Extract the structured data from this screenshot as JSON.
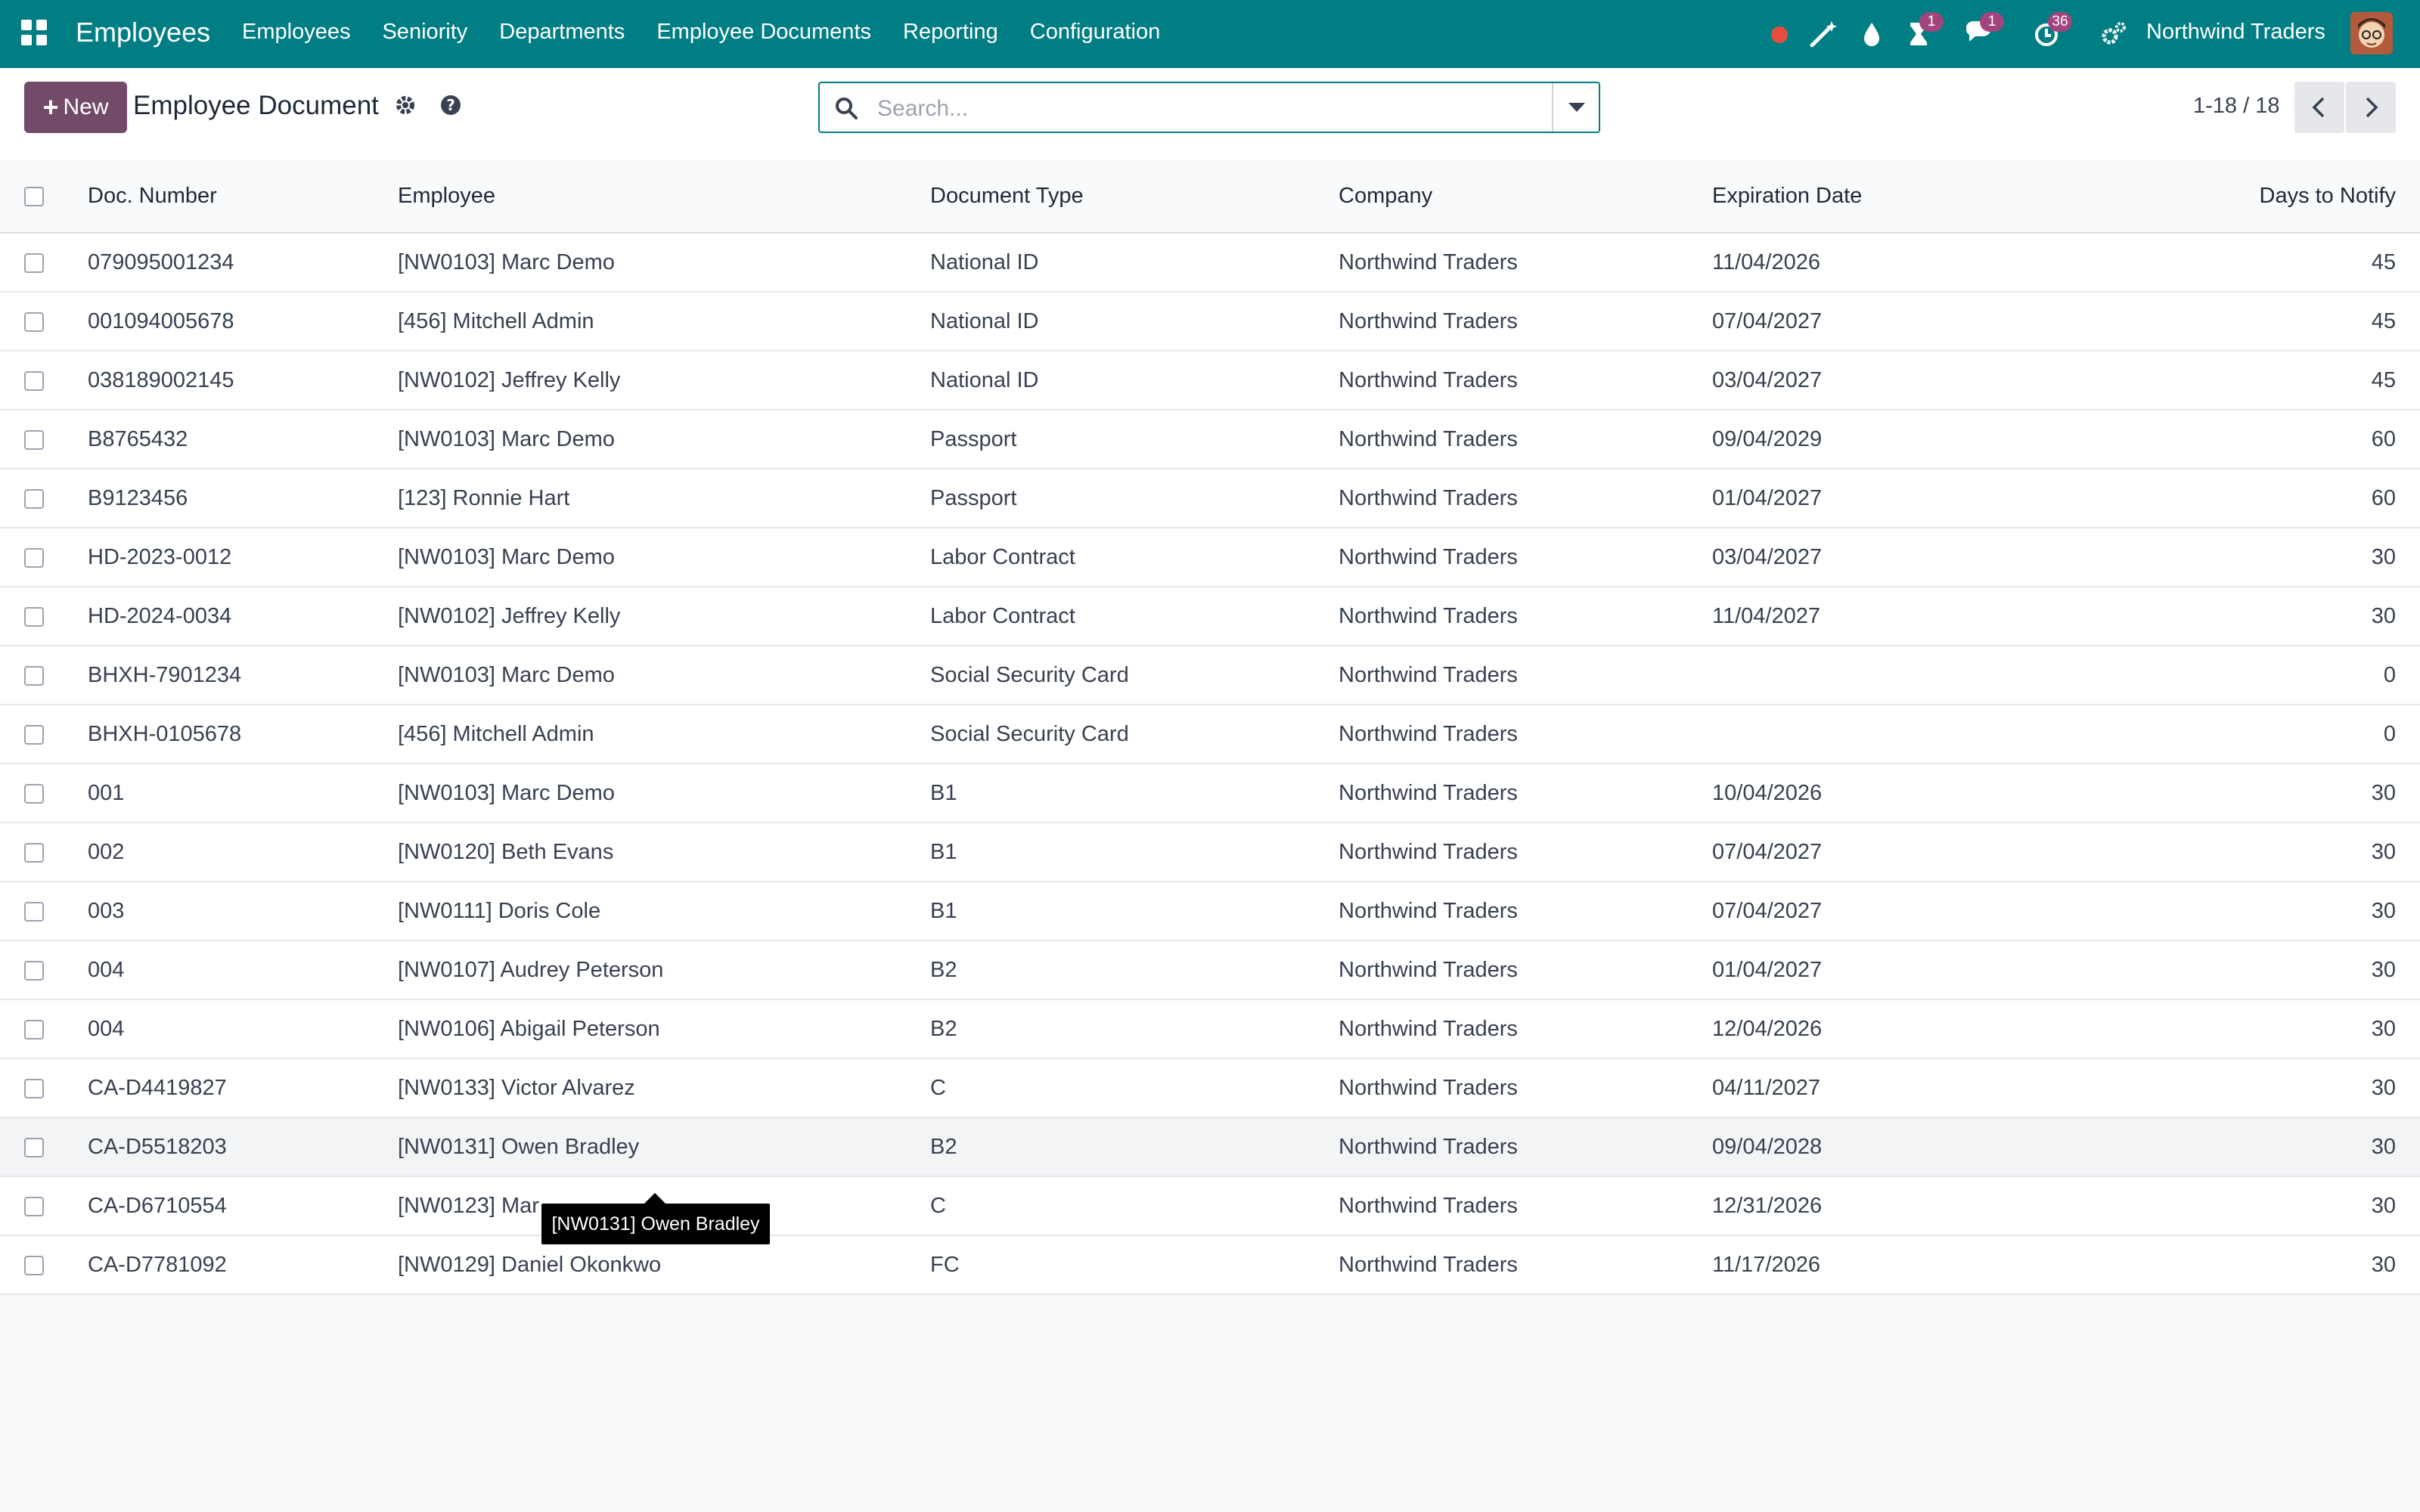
{
  "navbar": {
    "app_name": "Employees",
    "menu": [
      "Employees",
      "Seniority",
      "Departments",
      "Employee Documents",
      "Reporting",
      "Configuration"
    ],
    "activity_badge": "1",
    "messages_badge": "1",
    "clock_badge": "36",
    "company": "Northwind Traders",
    "icons": [
      "record-dot-icon",
      "magic-wand-icon",
      "water-drop-icon",
      "hourglass-icon",
      "chat-icon",
      "clock-icon",
      "settings-icon"
    ]
  },
  "control_panel": {
    "new_label": "New",
    "title": "Employee Document",
    "search_placeholder": "Search...",
    "pager": "1-18 / 18"
  },
  "columns": [
    "Doc. Number",
    "Employee",
    "Document Type",
    "Company",
    "Expiration Date",
    "Days to Notify"
  ],
  "rows": [
    {
      "doc": "079095001234",
      "employee": "[NW0103] Marc Demo",
      "type": "National ID",
      "company": "Northwind Traders",
      "expiration": "11/04/2026",
      "days": "45"
    },
    {
      "doc": "001094005678",
      "employee": "[456] Mitchell Admin",
      "type": "National ID",
      "company": "Northwind Traders",
      "expiration": "07/04/2027",
      "days": "45"
    },
    {
      "doc": "038189002145",
      "employee": "[NW0102] Jeffrey Kelly",
      "type": "National ID",
      "company": "Northwind Traders",
      "expiration": "03/04/2027",
      "days": "45"
    },
    {
      "doc": "B8765432",
      "employee": "[NW0103] Marc Demo",
      "type": "Passport",
      "company": "Northwind Traders",
      "expiration": "09/04/2029",
      "days": "60"
    },
    {
      "doc": "B9123456",
      "employee": "[123] Ronnie Hart",
      "type": "Passport",
      "company": "Northwind Traders",
      "expiration": "01/04/2027",
      "days": "60"
    },
    {
      "doc": "HD-2023-0012",
      "employee": "[NW0103] Marc Demo",
      "type": "Labor Contract",
      "company": "Northwind Traders",
      "expiration": "03/04/2027",
      "days": "30"
    },
    {
      "doc": "HD-2024-0034",
      "employee": "[NW0102] Jeffrey Kelly",
      "type": "Labor Contract",
      "company": "Northwind Traders",
      "expiration": "11/04/2027",
      "days": "30"
    },
    {
      "doc": "BHXH-7901234",
      "employee": "[NW0103] Marc Demo",
      "type": "Social Security Card",
      "company": "Northwind Traders",
      "expiration": "",
      "days": "0"
    },
    {
      "doc": "BHXH-0105678",
      "employee": "[456] Mitchell Admin",
      "type": "Social Security Card",
      "company": "Northwind Traders",
      "expiration": "",
      "days": "0"
    },
    {
      "doc": "001",
      "employee": "[NW0103] Marc Demo",
      "type": "B1",
      "company": "Northwind Traders",
      "expiration": "10/04/2026",
      "days": "30"
    },
    {
      "doc": "002",
      "employee": "[NW0120] Beth Evans",
      "type": "B1",
      "company": "Northwind Traders",
      "expiration": "07/04/2027",
      "days": "30"
    },
    {
      "doc": "003",
      "employee": "[NW0111] Doris Cole",
      "type": "B1",
      "company": "Northwind Traders",
      "expiration": "07/04/2027",
      "days": "30"
    },
    {
      "doc": "004",
      "employee": "[NW0107] Audrey Peterson",
      "type": "B2",
      "company": "Northwind Traders",
      "expiration": "01/04/2027",
      "days": "30"
    },
    {
      "doc": "004",
      "employee": "[NW0106] Abigail Peterson",
      "type": "B2",
      "company": "Northwind Traders",
      "expiration": "12/04/2026",
      "days": "30"
    },
    {
      "doc": "CA-D4419827",
      "employee": "[NW0133] Victor Alvarez",
      "type": "C",
      "company": "Northwind Traders",
      "expiration": "04/11/2027",
      "days": "30"
    },
    {
      "doc": "CA-D5518203",
      "employee": "[NW0131] Owen Bradley",
      "type": "B2",
      "company": "Northwind Traders",
      "expiration": "09/04/2028",
      "days": "30"
    },
    {
      "doc": "CA-D6710554",
      "employee": "[NW0123] Mar",
      "type": "C",
      "company": "Northwind Traders",
      "expiration": "12/31/2026",
      "days": "30"
    },
    {
      "doc": "CA-D7781092",
      "employee": "[NW0129] Daniel Okonkwo",
      "type": "FC",
      "company": "Northwind Traders",
      "expiration": "11/17/2026",
      "days": "30"
    }
  ],
  "tooltip": "[NW0131] Owen Bradley",
  "colors": {
    "navbar": "#017e84",
    "primary": "#714b67",
    "badge": "#a2457e",
    "record_dot": "#e74c3c"
  }
}
